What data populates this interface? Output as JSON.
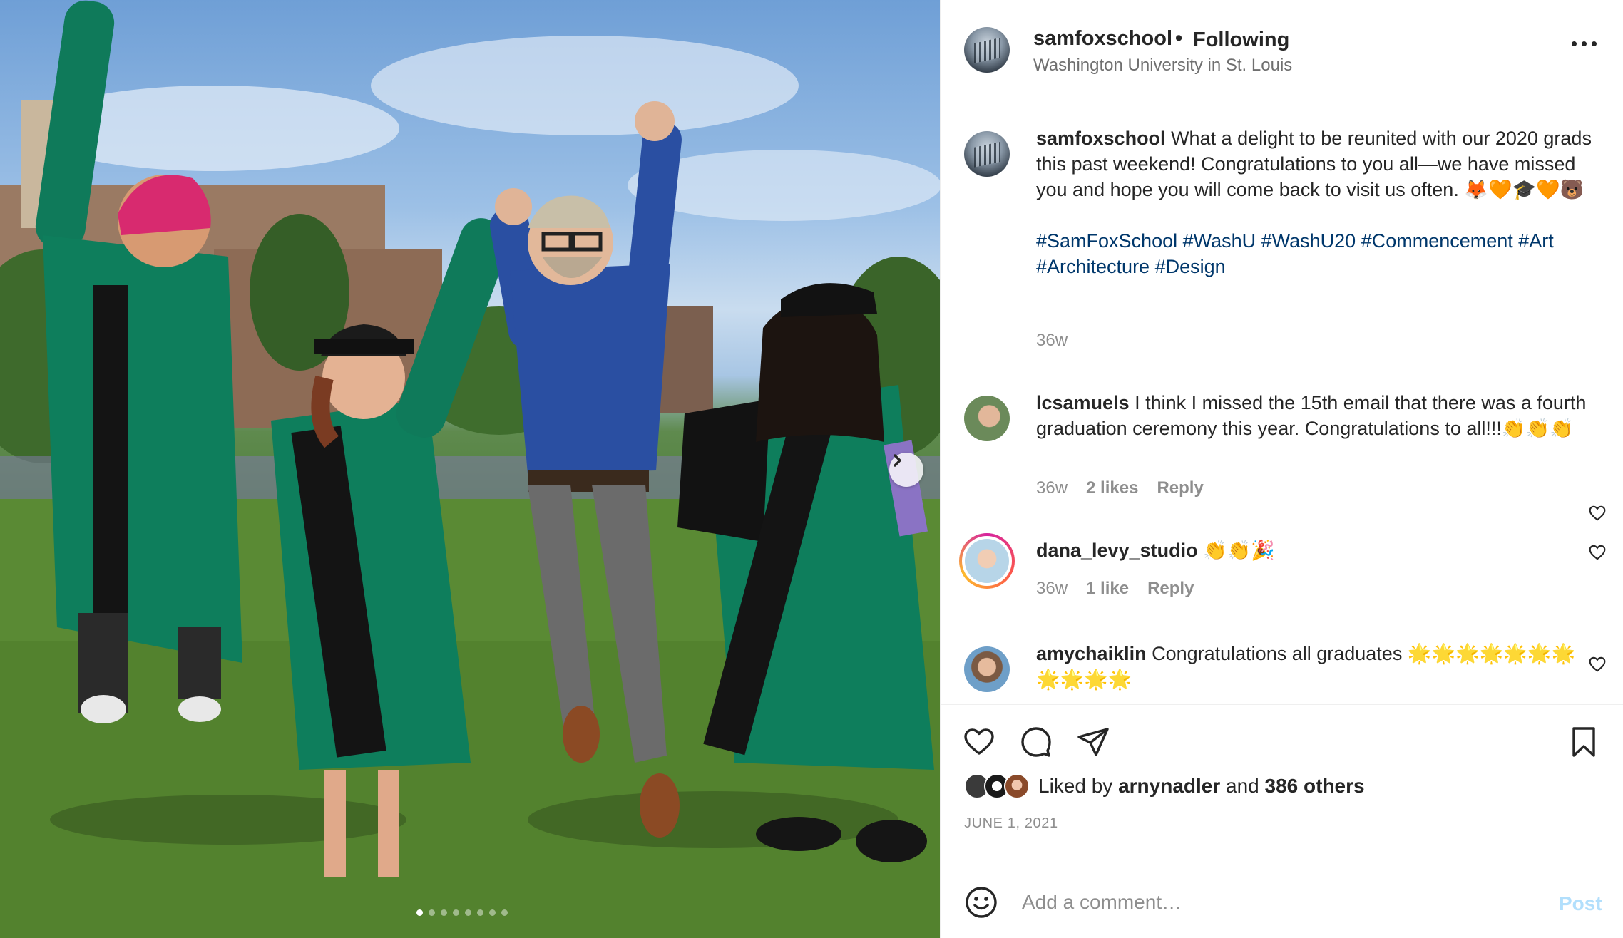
{
  "post": {
    "author": "samfoxschool",
    "separator": "•",
    "follow_state": "Following",
    "location": "Washington University in St. Louis",
    "more_icon": "more-icon",
    "carousel": {
      "active_index": 0,
      "total": 8
    }
  },
  "caption": {
    "user": "samfoxschool",
    "text": "What a delight to be reunited with our 2020 grads this past weekend! Congratulations to you all—we have missed you and hope you will come back to visit us often. 🦊🧡🎓🧡🐻",
    "hashtags": "#SamFoxSchool #WashU #WashU20 #Commencement #Art #Architecture #Design",
    "time": "36w"
  },
  "comments": [
    {
      "user": "lcsamuels",
      "text": "I think I missed the 15th email that there was a fourth graduation ceremony this year. Congratulations to all!!!👏👏👏",
      "time": "36w",
      "likes": "2 likes",
      "reply": "Reply"
    },
    {
      "user": "dana_levy_studio",
      "text": "👏👏🎉",
      "time": "36w",
      "likes": "1 like",
      "reply": "Reply"
    },
    {
      "user": "amychaiklin",
      "text": "Congratulations all graduates 🌟🌟🌟🌟🌟🌟🌟🌟🌟🌟🌟"
    }
  ],
  "actions": {
    "liked_prefix": "Liked by",
    "liked_user": "arnynadler",
    "liked_and": "and",
    "liked_others": "386 others",
    "date": "JUNE 1, 2021"
  },
  "composer": {
    "placeholder": "Add a comment…",
    "post_label": "Post"
  },
  "colors": {
    "link": "#00376b",
    "post_disabled": "#b2dffc",
    "muted": "#8e8e8e"
  }
}
